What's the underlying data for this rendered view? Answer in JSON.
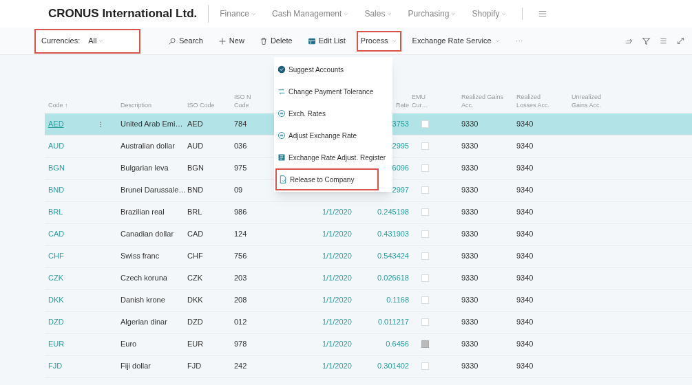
{
  "company": "CRONUS International Ltd.",
  "nav": [
    {
      "label": "Finance"
    },
    {
      "label": "Cash Management"
    },
    {
      "label": "Sales"
    },
    {
      "label": "Purchasing"
    },
    {
      "label": "Shopify"
    }
  ],
  "filter": {
    "label": "Currencies:",
    "value": "All",
    "highlighted": true
  },
  "actions": [
    {
      "kind": "search",
      "label": "Search",
      "highlighted": false
    },
    {
      "kind": "new",
      "label": "New",
      "highlighted": false
    },
    {
      "kind": "delete",
      "label": "Delete",
      "highlighted": false
    },
    {
      "kind": "editlist",
      "label": "Edit List",
      "highlighted": false
    },
    {
      "kind": "dropdown",
      "label": "Process",
      "highlighted": true
    },
    {
      "kind": "dropdown",
      "label": "Exchange Rate Service",
      "highlighted": false
    },
    {
      "kind": "more",
      "label": "···",
      "highlighted": false
    }
  ],
  "menu": [
    {
      "kind": "check",
      "label": "Suggest Accounts",
      "highlighted": false
    },
    {
      "kind": "tolerance",
      "label": "Change Payment Tolerance",
      "highlighted": false
    },
    {
      "kind": "rates",
      "label": "Exch. Rates",
      "highlighted": false
    },
    {
      "kind": "rates",
      "label": "Adjust Exchange Rate",
      "highlighted": false
    },
    {
      "kind": "register",
      "label": "Exchange Rate Adjust. Register",
      "highlighted": false
    },
    {
      "kind": "document",
      "label": "Release to Company",
      "highlighted": true
    }
  ],
  "columns": [
    "Code ↑",
    "Description",
    "ISO Code",
    "ISO N\nCode",
    "",
    "Rate",
    "EMU\nCur…",
    "Realized Gains\nAcc.",
    "Realized\nLosses Acc.",
    "Unrealized\nGains Acc."
  ],
  "rows": [
    {
      "code": "AED",
      "description": "United Arab Emi…",
      "iso_code": "AED",
      "iso_numeric": "784",
      "rate": "3753",
      "emu": false,
      "gains": "9330",
      "losses": "9340",
      "selected": true
    },
    {
      "code": "AUD",
      "description": "Australian dollar",
      "iso_code": "AUD",
      "iso_numeric": "036",
      "rate": "2995",
      "emu": false,
      "gains": "9330",
      "losses": "9340",
      "selected": false
    },
    {
      "code": "BGN",
      "description": "Bulgarian leva",
      "iso_code": "BGN",
      "iso_numeric": "975",
      "rate": "6096",
      "emu": false,
      "gains": "9330",
      "losses": "9340",
      "selected": false
    },
    {
      "code": "BND",
      "description": "Brunei Darussale…",
      "iso_code": "BND",
      "iso_numeric": "09",
      "rate": "2997",
      "emu": false,
      "gains": "9330",
      "losses": "9340",
      "selected": false
    },
    {
      "code": "BRL",
      "description": "Brazilian real",
      "iso_code": "BRL",
      "iso_numeric": "986",
      "date": "1/1/2020",
      "rate": "0.245198",
      "emu": false,
      "gains": "9330",
      "losses": "9340",
      "selected": false
    },
    {
      "code": "CAD",
      "description": "Canadian dollar",
      "iso_code": "CAD",
      "iso_numeric": "124",
      "date": "1/1/2020",
      "rate": "0.431903",
      "emu": false,
      "gains": "9330",
      "losses": "9340",
      "selected": false
    },
    {
      "code": "CHF",
      "description": "Swiss franc",
      "iso_code": "CHF",
      "iso_numeric": "756",
      "date": "1/1/2020",
      "rate": "0.543424",
      "emu": false,
      "gains": "9330",
      "losses": "9340",
      "selected": false
    },
    {
      "code": "CZK",
      "description": "Czech koruna",
      "iso_code": "CZK",
      "iso_numeric": "203",
      "date": "1/1/2020",
      "rate": "0.026618",
      "emu": false,
      "gains": "9330",
      "losses": "9340",
      "selected": false
    },
    {
      "code": "DKK",
      "description": "Danish krone",
      "iso_code": "DKK",
      "iso_numeric": "208",
      "date": "1/1/2020",
      "rate": "0.1168",
      "emu": false,
      "gains": "9330",
      "losses": "9340",
      "selected": false
    },
    {
      "code": "DZD",
      "description": "Algerian dinar",
      "iso_code": "DZD",
      "iso_numeric": "012",
      "date": "1/1/2020",
      "rate": "0.011217",
      "emu": false,
      "gains": "9330",
      "losses": "9340",
      "selected": false
    },
    {
      "code": "EUR",
      "description": "Euro",
      "iso_code": "EUR",
      "iso_numeric": "978",
      "date": "1/1/2020",
      "rate": "0.6456",
      "emu": true,
      "gains": "9330",
      "losses": "9340",
      "selected": false
    },
    {
      "code": "FJD",
      "description": "Fiji dollar",
      "iso_code": "FJD",
      "iso_numeric": "242",
      "date": "1/1/2020",
      "rate": "0.301402",
      "emu": false,
      "gains": "9330",
      "losses": "9340",
      "selected": false
    }
  ]
}
